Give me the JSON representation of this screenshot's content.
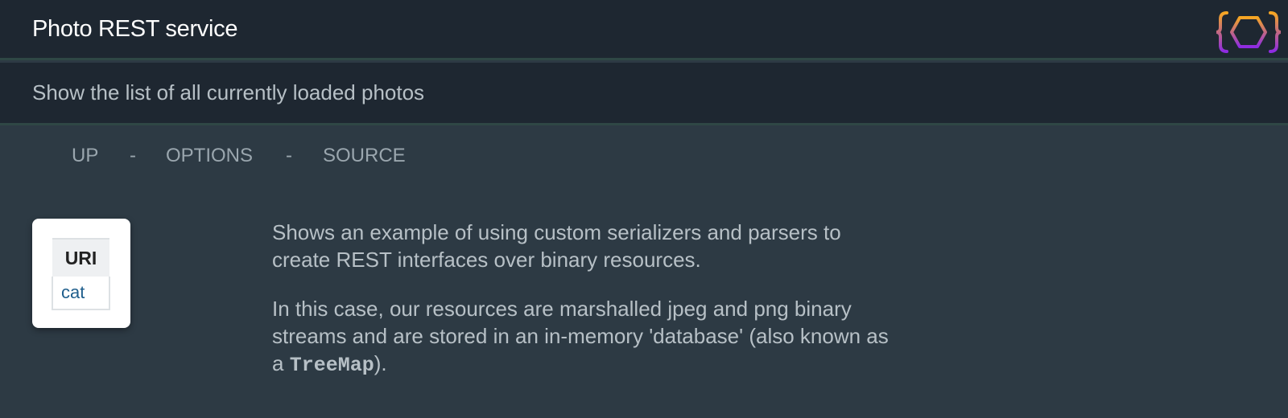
{
  "header": {
    "title": "Photo REST service",
    "logo_icon": "curly-brace-hexagon-logo"
  },
  "subheader": {
    "description": "Show the list of all currently loaded photos"
  },
  "nav": {
    "items": [
      {
        "label": "UP"
      },
      {
        "label": "OPTIONS"
      },
      {
        "label": "SOURCE"
      }
    ],
    "separator": "-"
  },
  "uri_table": {
    "header": "URI",
    "rows": [
      "cat"
    ]
  },
  "description": {
    "paragraph1": "Shows an example of using custom serializers and parsers to create REST interfaces over binary resources.",
    "paragraph2_before": "In this case, our resources are marshalled jpeg and png binary streams and are stored in an in-memory 'database' (also known as a ",
    "paragraph2_code": "TreeMap",
    "paragraph2_after": ")."
  },
  "colors": {
    "background": "#2d3a44",
    "bar": "#1e2731",
    "bar_border": "#2f4745",
    "link": "#1f5e8c",
    "logo_orange": "#f5a623",
    "logo_purple": "#8e2be2"
  }
}
